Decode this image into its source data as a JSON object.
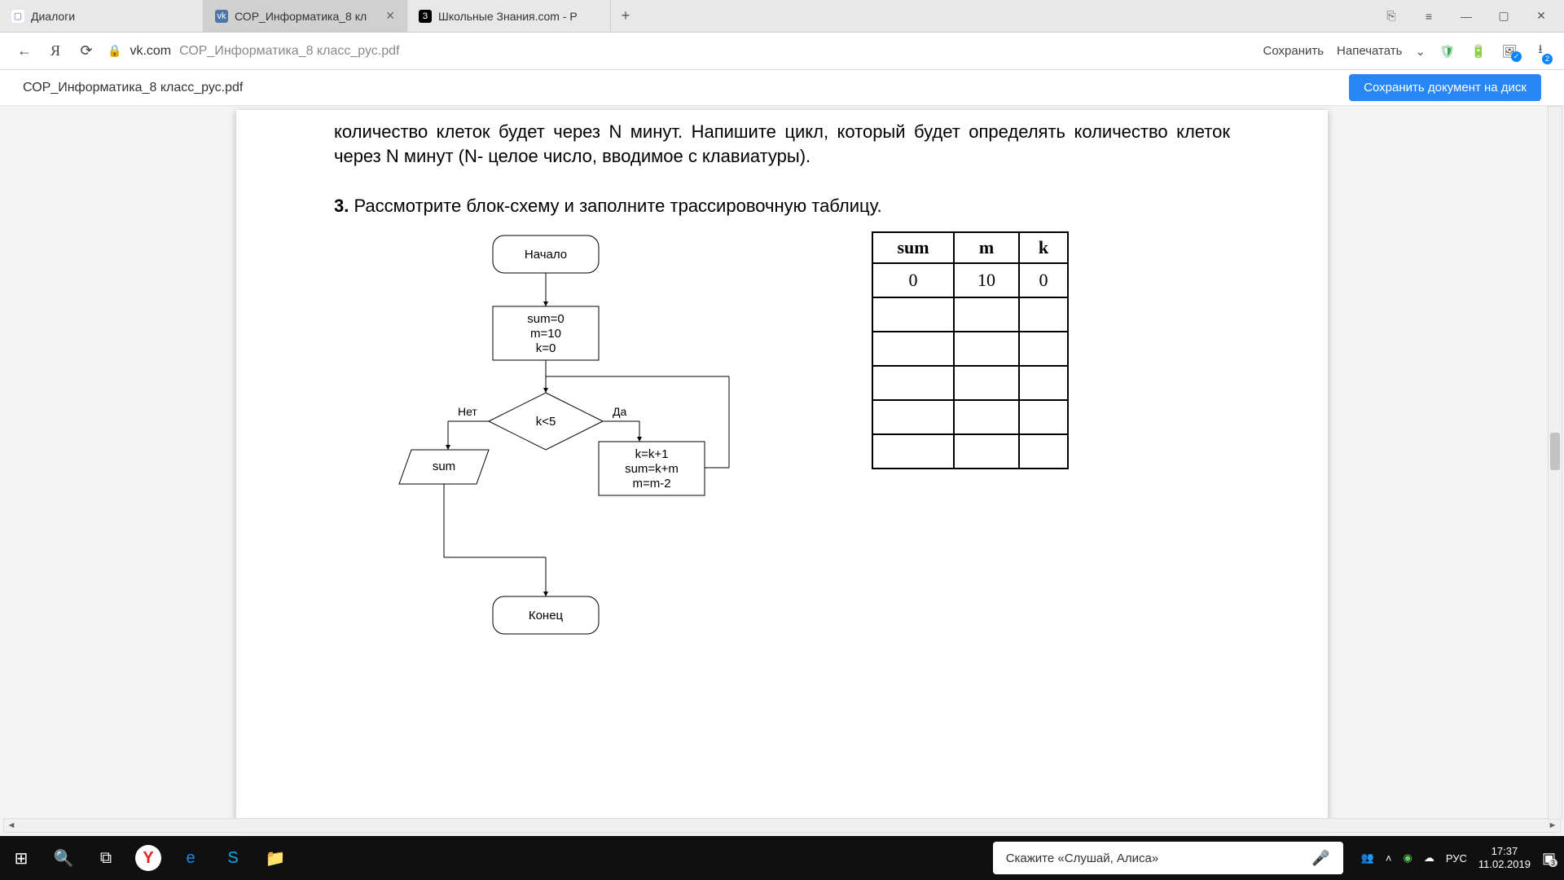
{
  "tabs": {
    "t0": {
      "label": "Диалоги"
    },
    "t1": {
      "label": "СОР_Информатика_8 кл"
    },
    "t2": {
      "label": "Школьные Знания.com - Р"
    }
  },
  "address": {
    "host": "vk.com",
    "path": "СОР_Информатика_8 класс_рус.pdf",
    "save": "Сохранить",
    "print": "Напечатать",
    "dl_badge": "2"
  },
  "subbar": {
    "filename": "СОР_Информатика_8 класс_рус.pdf",
    "save_disk": "Сохранить документ на диск"
  },
  "doc": {
    "para_cut": "количество клеток будет через N минут. Напишите цикл, который будет определять количество клеток через N минут (N- целое число, вводимое с клавиатуры).",
    "task3_num": "3.",
    "task3_text": "Рассмотрите блок-схему и заполните трассировочную таблицу.",
    "flow": {
      "start": "Начало",
      "init1": "sum=0",
      "init2": "m=10",
      "init3": "k=0",
      "cond": "k<5",
      "no": "Нет",
      "yes": "Да",
      "out": "sum",
      "body1": "k=k+1",
      "body2": "sum=k+m",
      "body3": "m=m-2",
      "end": "Конец"
    },
    "table": {
      "h0": "sum",
      "h1": "m",
      "h2": "k",
      "r0c0": "0",
      "r0c1": "10",
      "r0c2": "0"
    }
  },
  "alisa": {
    "prompt": "Скажите «Слушай, Алиса»"
  },
  "tray": {
    "lang": "РУС",
    "time": "17:37",
    "date": "11.02.2019",
    "notif": "3"
  }
}
